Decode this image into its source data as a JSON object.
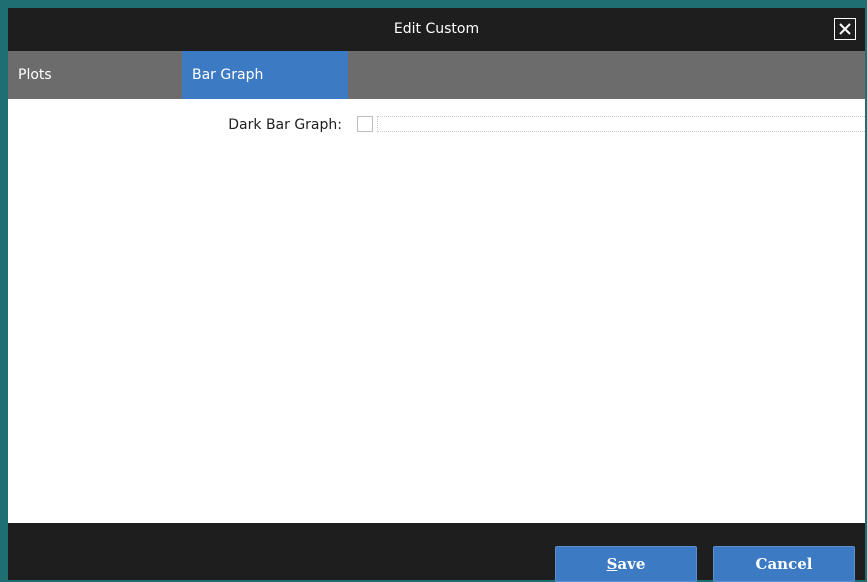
{
  "window": {
    "title": "Edit Custom",
    "close_icon": "close-icon"
  },
  "tabs": [
    {
      "label": "Plots",
      "selected": false
    },
    {
      "label": "Bar Graph",
      "selected": true
    }
  ],
  "form": {
    "dark_bar_graph_label": "Dark Bar Graph:",
    "dark_bar_graph_checked": false
  },
  "footer": {
    "save_label_first": "S",
    "save_label_rest": "ave",
    "cancel_label": "Cancel"
  },
  "colors": {
    "accent": "#3d7ac4",
    "frame": "#1f6f72",
    "tabbar": "#6c6c6c",
    "titlebar": "#1e1e1e"
  }
}
